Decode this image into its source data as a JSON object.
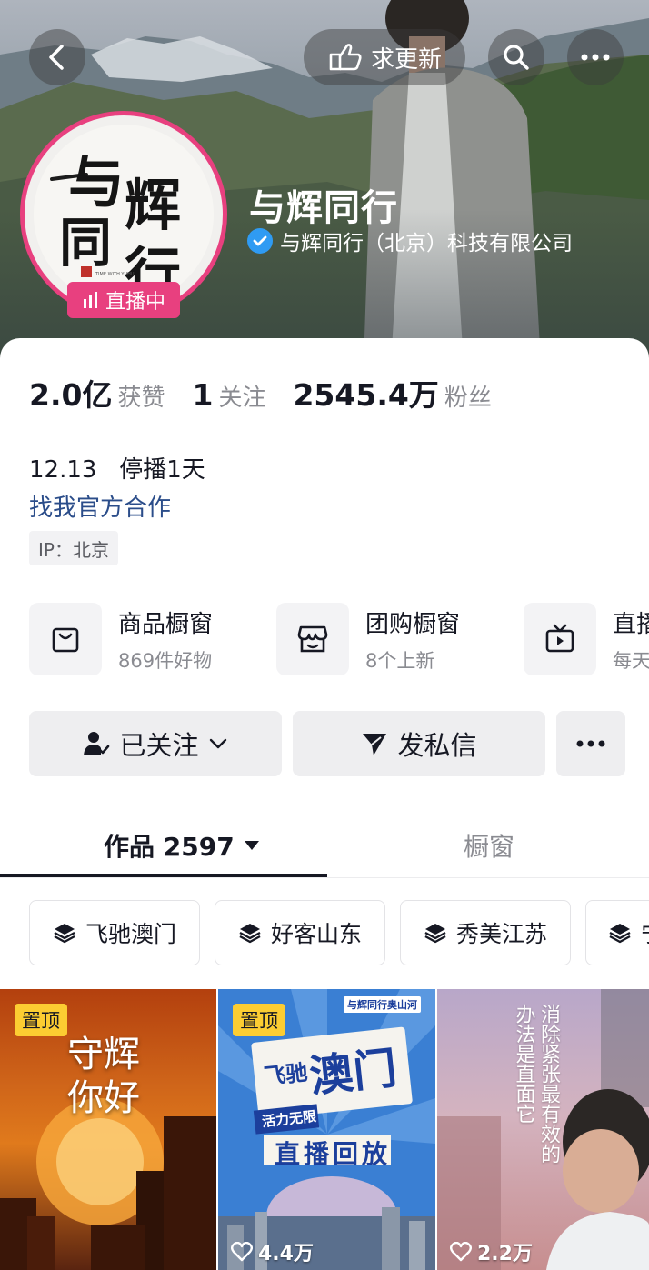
{
  "header": {
    "update_label": "求更新",
    "name": "与辉同行",
    "verified_org": "与辉同行（北京）科技有限公司",
    "live_label": "直播中",
    "avatar_text": [
      "与",
      "辉",
      "同",
      "行"
    ],
    "avatar_small": "TIME WITH YUHUI"
  },
  "stats": [
    {
      "value": "2.0亿",
      "label": "获赞"
    },
    {
      "value": "1",
      "label": "关注"
    },
    {
      "value": "2545.4万",
      "label": "粉丝"
    }
  ],
  "bio": {
    "line1": "12.13   停播1天",
    "link": "找我官方合作",
    "ip": "IP：北京"
  },
  "shops": [
    {
      "title": "商品橱窗",
      "sub": "869件好物",
      "icon": "shopping-bag-icon"
    },
    {
      "title": "团购橱窗",
      "sub": "8个上新",
      "icon": "storefront-icon"
    },
    {
      "title": "直播",
      "sub": "每天",
      "icon": "tv-icon"
    }
  ],
  "actions": {
    "follow_label": "已关注",
    "message_label": "发私信"
  },
  "tabs": {
    "works": "作品 2597",
    "window": "橱窗"
  },
  "chips": [
    "飞驰澳门",
    "好客山东",
    "秀美江苏",
    "宁"
  ],
  "videos": [
    {
      "pin": "置顶",
      "likes": "",
      "overlay": "守辉你好"
    },
    {
      "pin": "置顶",
      "likes": "4.4万",
      "title_big": "澳门",
      "title_small": "飞驰",
      "subtitle": "活力无限",
      "replay": "直播回放",
      "brand": "与辉同行奥山河"
    },
    {
      "pin": "",
      "likes": "2.2万",
      "overlay": "消除紧张最有效的办法是直面它"
    }
  ],
  "colors": {
    "accent_pink": "#e8407f",
    "verify_blue": "#2f9bf3",
    "link_blue": "#2b4d8a",
    "pin_yellow": "#fccd32"
  }
}
